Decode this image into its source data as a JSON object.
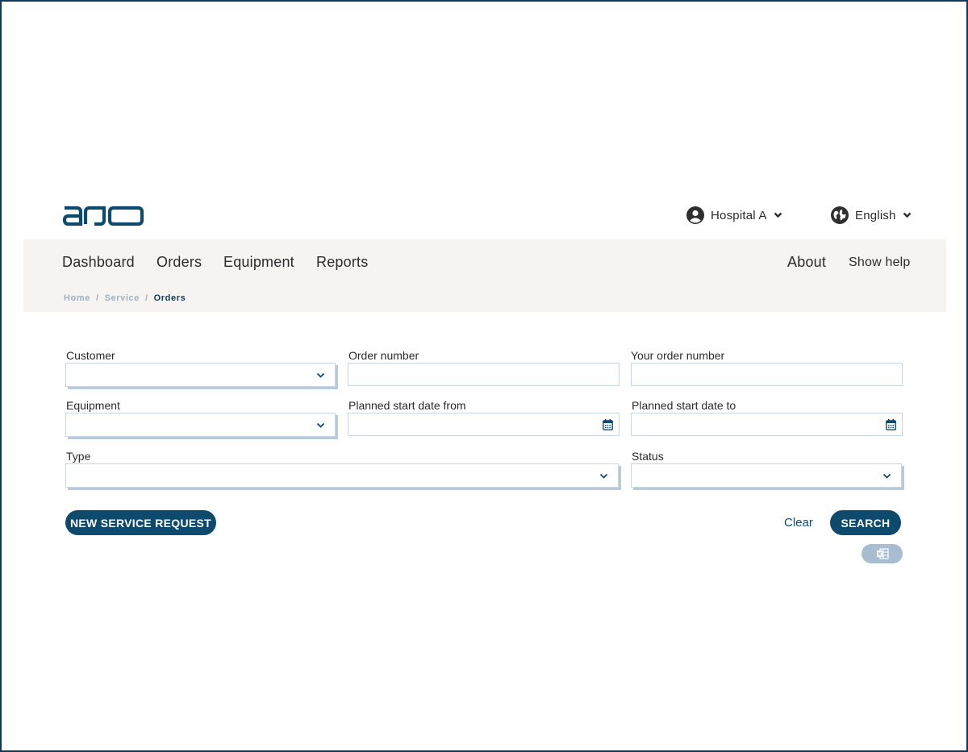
{
  "brand": {
    "logo_text": "arjo",
    "color": "#0d4a6e"
  },
  "header": {
    "user": {
      "icon": "user-circle-icon",
      "label": "Hospital A"
    },
    "language": {
      "icon": "globe-icon",
      "label": "English"
    }
  },
  "nav": {
    "items": [
      {
        "label": "Dashboard"
      },
      {
        "label": "Orders"
      },
      {
        "label": "Equipment"
      },
      {
        "label": "Reports"
      }
    ],
    "about": "About",
    "help": "Show help"
  },
  "breadcrumb": {
    "items": [
      "Home",
      "Service",
      "Orders"
    ],
    "separator": "/"
  },
  "form": {
    "customer": {
      "label": "Customer",
      "value": ""
    },
    "order_number": {
      "label": "Order number",
      "value": "",
      "placeholder": ""
    },
    "your_order_number": {
      "label": "Your order number",
      "value": "",
      "placeholder": ""
    },
    "equipment": {
      "label": "Equipment",
      "value": ""
    },
    "planned_from": {
      "label": "Planned start date from",
      "value": "",
      "placeholder": ""
    },
    "planned_to": {
      "label": "Planned start date to",
      "value": "",
      "placeholder": ""
    },
    "type": {
      "label": "Type",
      "value": ""
    },
    "status": {
      "label": "Status",
      "value": ""
    }
  },
  "actions": {
    "new_request": "NEW SERVICE REQUEST",
    "clear": "Clear",
    "search": "SEARCH",
    "export_icon": "excel-icon"
  },
  "colors": {
    "primary": "#0d4a6e",
    "nav_bg": "#f6f3f1",
    "border": "#c8d6e2",
    "disabled": "#a8bdd0"
  }
}
